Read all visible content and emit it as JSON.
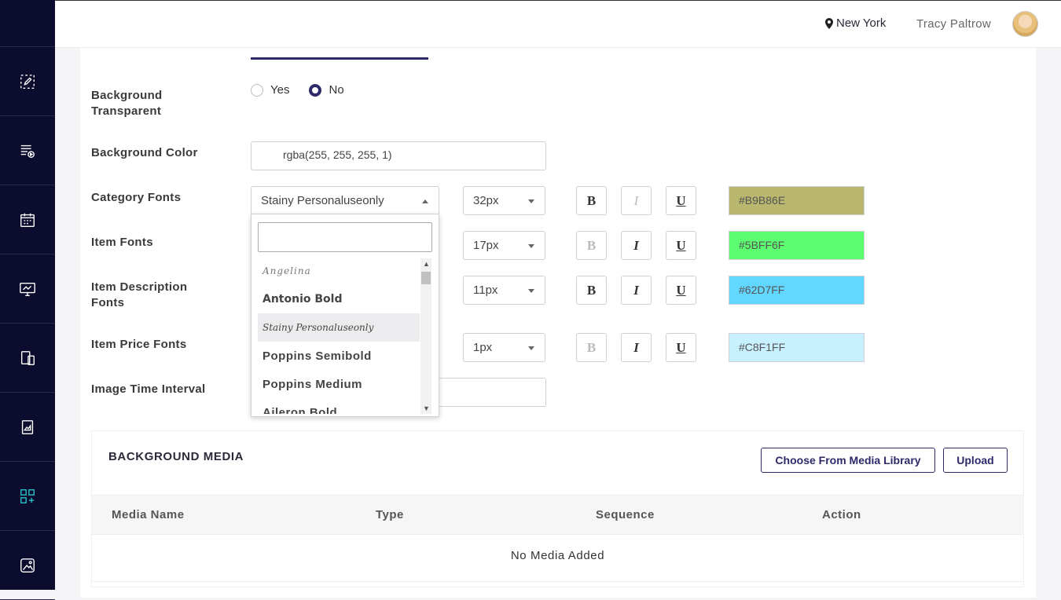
{
  "topbar": {
    "location": "New York",
    "user_name": "Tracy Paltrow"
  },
  "sidebar": {
    "items": [
      {
        "icon": "edit-icon"
      },
      {
        "icon": "playlist-icon"
      },
      {
        "icon": "calendar-icon"
      },
      {
        "icon": "monitor-icon"
      },
      {
        "icon": "devices-icon"
      },
      {
        "icon": "image-frame-icon"
      },
      {
        "icon": "apps-add-icon",
        "active": true
      },
      {
        "icon": "gallery-icon"
      }
    ],
    "active_color": "#28c3c8"
  },
  "form": {
    "bg_transparent": {
      "label": "Background Transparent",
      "opt_yes": "Yes",
      "opt_no": "No",
      "selected": "No"
    },
    "bg_color": {
      "label": "Background Color",
      "value": "rgba(255, 255, 255, 1)"
    },
    "category_fonts": {
      "label": "Category Fonts",
      "font": "Stainy Personaluseonly",
      "size": "32px",
      "bold": true,
      "italic": false,
      "underline": true,
      "color": "#B9B86E"
    },
    "item_fonts": {
      "label": "Item Fonts",
      "size": "17px",
      "bold": false,
      "italic": true,
      "underline": true,
      "color": "#5BFF6F"
    },
    "item_desc_fonts": {
      "label": "Item Description Fonts",
      "size": "11px",
      "bold": true,
      "italic": true,
      "underline": true,
      "color": "#62D7FF"
    },
    "item_price_fonts": {
      "label": "Item Price Fonts",
      "size": "1px",
      "bold": false,
      "italic": true,
      "underline": true,
      "color": "#C8F1FF"
    },
    "image_time_interval": {
      "label": "Image Time Interval"
    },
    "style_buttons": {
      "bold": "B",
      "italic": "I",
      "underline": "U"
    }
  },
  "font_dropdown": {
    "options": [
      "Angelina",
      "Antonio Bold",
      "Stainy Personaluseonly",
      "Poppins Semibold",
      "Poppins Medium",
      "Aileron Bold"
    ],
    "highlighted": "Stainy Personaluseonly"
  },
  "media": {
    "title": "BACKGROUND MEDIA",
    "choose_btn": "Choose From Media Library",
    "upload_btn": "Upload",
    "columns": [
      "Media Name",
      "Type",
      "Sequence",
      "Action"
    ],
    "empty_text": "No Media Added"
  }
}
